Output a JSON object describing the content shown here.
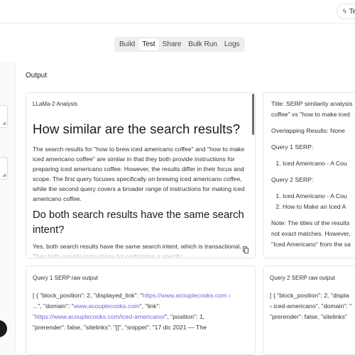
{
  "topbar": {
    "chip_label": "Te"
  },
  "tabs": [
    "Build",
    "Test",
    "Share",
    "Bulk Run",
    "Logs"
  ],
  "active_tab": "Test",
  "output_label": "Output",
  "analysis": {
    "title": "LLaMa-2 Analysis",
    "heading1": "How similar are the search results?",
    "paragraph1": "The search results for \"how to brew iced americano coffee\" and \"how to make iced americano coffee\" are similar in that they both provide instructions for preparing iced americano coffee. However, the results differ in their focus and scope. The first query focuses specifically on brewing iced americano coffee, while the second query covers a broader range of instructions for making iced americano coffee.",
    "heading2": "Do both search results have the same search intent?",
    "paragraph2": "Yes, both search results have the same search intent, which is transactional. They both provide instructions for performing a specific"
  },
  "similarity": {
    "line1": "Title: SERP similarity analysis",
    "line2": "coffee\" vs \"how to make iced",
    "overlap": "Overlapping Results: None",
    "q1_label": "Query 1 SERP:",
    "q1_items": [
      "Iced Americano - A Cou"
    ],
    "q2_label": "Query 2 SERP:",
    "q2_items": [
      "Iced Americano - A Cou",
      "How to Make an Iced A"
    ],
    "note1": "Note: The titles of the results",
    "note2": "not exact matches. However,",
    "note3": "\"Iced Americano\" from the sa"
  },
  "raw1": {
    "title": "Query 1 SERP raw output",
    "t1": "[ { \"block_position\": 2, \"displayed_link\": \"",
    "l1": "https://www.acouplecooks.com ›",
    "t2": "...\", \"domain\": \"",
    "l2": "www.acouplecooks.com",
    "t3": "\", \"link\":",
    "l3": "\"https://www.acouplecooks.com/iced-americano/",
    "t4": "\", \"position\": 1,",
    "t5": "\"prerender\": false, \"sitelinks\": \"[]\", \"snippet\": \"17 dic 2021 — The"
  },
  "raw2": {
    "title": "Query 2 SERP raw output",
    "t1": "[ { \"block_position\": 2, \"displa",
    "t2": "› iced-americano\", \"domain\": \"",
    "t3": "\"prerender\": false, \"sitelinks\""
  },
  "colors": {
    "link": "#7b5fd6",
    "fab": "#1c1c1e",
    "tab_bg": "#eeeeee"
  },
  "icons": {
    "top_chip": "bolt-icon",
    "copy": "copy-icon"
  }
}
